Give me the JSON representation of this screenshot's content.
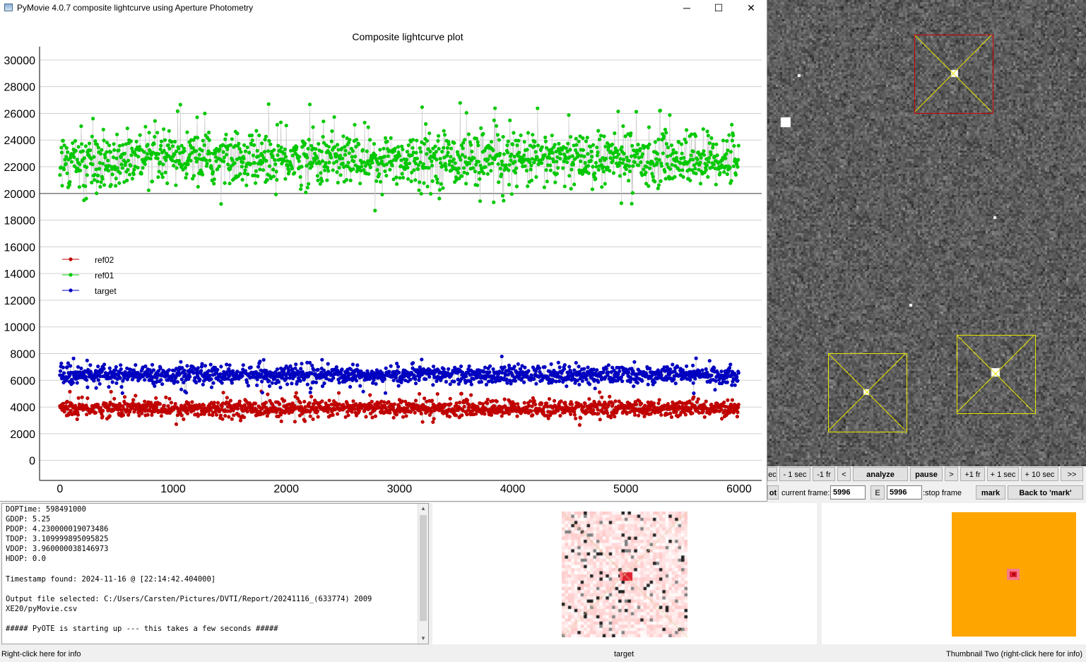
{
  "window": {
    "title": "PyMovie 4.0.7 composite lightcurve using Aperture Photometry",
    "minimize_glyph": "─",
    "maximize_glyph": "☐",
    "close_glyph": "✕"
  },
  "chart_data": {
    "type": "scatter",
    "title": "Composite lightcurve plot",
    "xlabel": "",
    "ylabel": "",
    "xlim": [
      -180,
      6200
    ],
    "ylim": [
      -1500,
      31000
    ],
    "x_ticks": [
      0,
      1000,
      2000,
      3000,
      4000,
      5000,
      6000
    ],
    "y_ticks": [
      0,
      2000,
      4000,
      6000,
      8000,
      10000,
      12000,
      14000,
      16000,
      18000,
      20000,
      22000,
      24000,
      26000,
      28000,
      30000
    ],
    "grid": "horizontal",
    "reference_line_y": 20000,
    "legend_position": "upper-left",
    "point_count_per_series": 6000,
    "x_range": [
      0,
      5999
    ],
    "series": [
      {
        "name": "ref02",
        "color": "#c00000",
        "mean": 3900,
        "spread": 550,
        "min": 2200,
        "max": 5600
      },
      {
        "name": "ref01",
        "color": "#00c800",
        "mean": 22600,
        "spread": 1800,
        "min": 16200,
        "max": 29600
      },
      {
        "name": "target",
        "color": "#0000c0",
        "mean": 6400,
        "spread": 600,
        "min": 4300,
        "max": 8600
      }
    ],
    "connector_color": "#c8c8c8"
  },
  "controls": {
    "row1": [
      "ec",
      "- 1 sec",
      "-1 fr",
      "<",
      "analyze",
      "pause",
      ">",
      "+1 fr",
      "+ 1 sec",
      "+ 10 sec",
      ">>"
    ],
    "row2_left_btn": "ot",
    "current_frame_label": "current frame:",
    "current_frame_value": "5996",
    "e_button": "E",
    "stop_frame_value": "5996",
    "stop_frame_label": ":stop frame",
    "mark_button": "mark",
    "back_button": "Back to 'mark'"
  },
  "log": {
    "lines": [
      "DOPTime: 598491000",
      "GDOP: 5.25",
      "PDOP: 4.230000019073486",
      "TDOP: 3.109999895095825",
      "VDOP: 3.960000038146973",
      "HDOP: 0.0",
      "",
      "Timestamp found: 2024-11-16 @ [22:14:42.404000]",
      "",
      "Output file selected: C:/Users/Carsten/Pictures/DVTI/Report/20241116_(633774) 2009",
      "XE20/pyMovie.csv",
      "",
      "##### PyOTE is starting up --- this takes a few seconds #####"
    ],
    "scroll_up": "▲",
    "scroll_down": "▼"
  },
  "status": {
    "left": "Right-click here for info",
    "center": "target",
    "right": "Thumbnail Two (right-click here for info)"
  },
  "colors": {
    "aperture_yellow": "#e6e600",
    "aperture_red": "#d40000",
    "thumbnail_two_bg": "#ffa500"
  }
}
